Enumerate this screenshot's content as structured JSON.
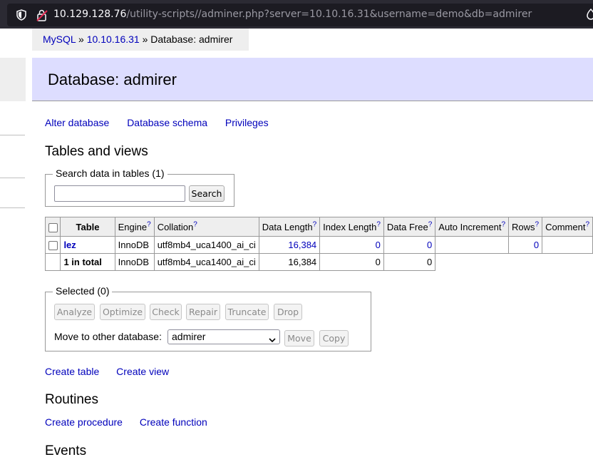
{
  "browser": {
    "url_host": "10.129.128.76",
    "url_rest": "/utility-scripts//adminer.php?server=10.10.16.31&username=demo&db=admirer"
  },
  "breadcrumb": {
    "link1": "MySQL",
    "sep1": " » ",
    "link2": "10.10.16.31",
    "sep2": " » ",
    "current": "Database: admirer"
  },
  "page_title": "Database: admirer",
  "db_links": [
    "Alter database",
    "Database schema",
    "Privileges"
  ],
  "tables_section": {
    "heading": "Tables and views",
    "search_legend": "Search data in tables (1)",
    "search_value": "",
    "search_button": "Search"
  },
  "table": {
    "columns": [
      {
        "label": "Table",
        "help": ""
      },
      {
        "label": "Engine",
        "help": "?"
      },
      {
        "label": "Collation",
        "help": "?"
      },
      {
        "label": "Data Length",
        "help": "?"
      },
      {
        "label": "Index Length",
        "help": "?"
      },
      {
        "label": "Data Free",
        "help": "?"
      },
      {
        "label": "Auto Increment",
        "help": "?"
      },
      {
        "label": "Rows",
        "help": "?"
      },
      {
        "label": "Comment",
        "help": "?"
      }
    ],
    "rows": [
      {
        "name": "lez",
        "engine": "InnoDB",
        "collation": "utf8mb4_uca1400_ai_ci",
        "data_length": "16,384",
        "index_length": "0",
        "data_free": "0",
        "auto_increment": "",
        "rows": "0",
        "comment": ""
      }
    ],
    "total": {
      "label": "1 in total",
      "engine": "InnoDB",
      "collation": "utf8mb4_uca1400_ai_ci",
      "data_length": "16,384",
      "index_length": "0",
      "data_free": "0"
    }
  },
  "selected": {
    "legend": "Selected (0)",
    "buttons": [
      "Analyze",
      "Optimize",
      "Check",
      "Repair",
      "Truncate",
      "Drop"
    ],
    "move_label": "Move to other database:",
    "move_select_value": "admirer",
    "move_button": "Move",
    "copy_button": "Copy"
  },
  "create_links": [
    "Create table",
    "Create view"
  ],
  "routines": {
    "heading": "Routines",
    "links": [
      "Create procedure",
      "Create function"
    ]
  },
  "events": {
    "heading": "Events"
  }
}
